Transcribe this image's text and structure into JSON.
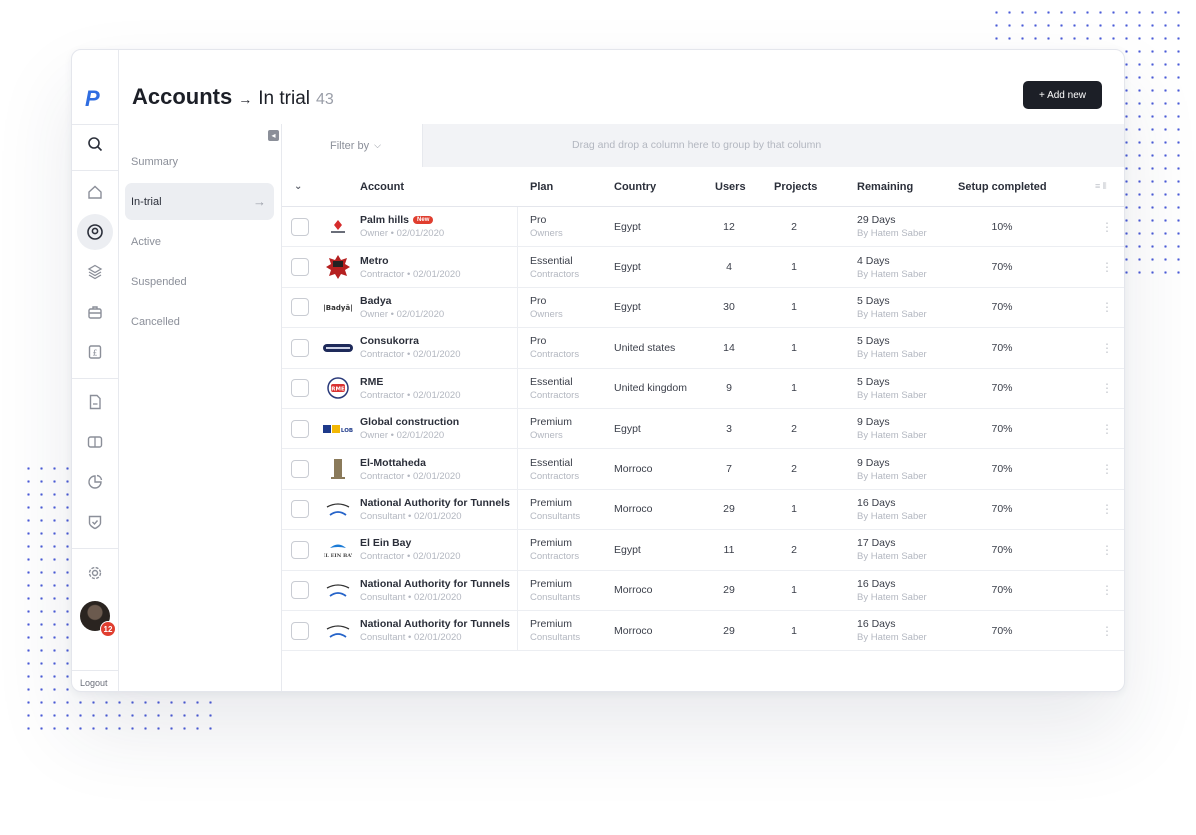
{
  "brand": {
    "logo": "P",
    "accent": "#2f6de1"
  },
  "header": {
    "title": "Accounts",
    "arrow": "→",
    "subtitle": "In trial",
    "count": "43",
    "add_button": "+ Add new"
  },
  "rail": {
    "icons": [
      "search-icon",
      "home-icon",
      "accounts-icon",
      "modules-icon",
      "briefcase-icon",
      "pound-icon",
      "document-icon",
      "card-icon",
      "pie-chart-icon",
      "shield-check-icon",
      "settings-icon"
    ],
    "badge": "12",
    "logout": "Logout"
  },
  "sidebar": {
    "items": [
      {
        "label": "Summary"
      },
      {
        "label": "In-trial",
        "arrow": "→"
      },
      {
        "label": "Active"
      },
      {
        "label": "Suspended"
      },
      {
        "label": "Cancelled"
      }
    ]
  },
  "toolbar": {
    "filter": "Filter by",
    "drag_hint": "Drag and drop a column here to group by that column"
  },
  "table": {
    "columns": [
      "Account",
      "Plan",
      "Country",
      "Users",
      "Projects",
      "Remaining",
      "Setup completed"
    ],
    "rows": [
      {
        "name": "Palm hills",
        "badge": "New",
        "role": "Owner • 02/01/2020",
        "plan": "Pro",
        "plan_group": "Owners",
        "country": "Egypt",
        "users": "12",
        "projects": "2",
        "remaining": "29 Days",
        "by": "By Hatem Saber",
        "setup": "10%",
        "logo": "palm"
      },
      {
        "name": "Metro",
        "badge": "",
        "role": "Contractor • 02/01/2020",
        "plan": "Essential",
        "plan_group": "Contractors",
        "country": "Egypt",
        "users": "4",
        "projects": "1",
        "remaining": "4 Days",
        "by": "By Hatem Saber",
        "setup": "70%",
        "logo": "metro"
      },
      {
        "name": "Badya",
        "badge": "",
        "role": "Owner • 02/01/2020",
        "plan": "Pro",
        "plan_group": "Owners",
        "country": "Egypt",
        "users": "30",
        "projects": "1",
        "remaining": "5 Days",
        "by": "By Hatem Saber",
        "setup": "70%",
        "logo": "badya"
      },
      {
        "name": "Consukorra",
        "badge": "",
        "role": "Contractor • 02/01/2020",
        "plan": "Pro",
        "plan_group": "Contractors",
        "country": "United states",
        "users": "14",
        "projects": "1",
        "remaining": "5 Days",
        "by": "By Hatem Saber",
        "setup": "70%",
        "logo": "consu"
      },
      {
        "name": "RME",
        "badge": "",
        "role": "Contractor • 02/01/2020",
        "plan": "Essential",
        "plan_group": "Contractors",
        "country": "United kingdom",
        "users": "9",
        "projects": "1",
        "remaining": "5 Days",
        "by": "By Hatem Saber",
        "setup": "70%",
        "logo": "rme"
      },
      {
        "name": "Global construction",
        "badge": "",
        "role": "Owner • 02/01/2020",
        "plan": "Premium",
        "plan_group": "Owners",
        "country": "Egypt",
        "users": "3",
        "projects": "2",
        "remaining": "9 Days",
        "by": "By Hatem Saber",
        "setup": "70%",
        "logo": "global"
      },
      {
        "name": "El-Mottaheda",
        "badge": "",
        "role": "Contractor • 02/01/2020",
        "plan": "Essential",
        "plan_group": "Contractors",
        "country": "Morroco",
        "users": "7",
        "projects": "2",
        "remaining": "9 Days",
        "by": "By Hatem Saber",
        "setup": "70%",
        "logo": "mott"
      },
      {
        "name": "National Authority for Tunnels",
        "badge": "",
        "role": "Consultant • 02/01/2020",
        "plan": "Premium",
        "plan_group": "Consultants",
        "country": "Morroco",
        "users": "29",
        "projects": "1",
        "remaining": "16 Days",
        "by": "By Hatem Saber",
        "setup": "70%",
        "logo": "nat"
      },
      {
        "name": "El Ein Bay",
        "badge": "",
        "role": "Contractor • 02/01/2020",
        "plan": "Premium",
        "plan_group": "Contractors",
        "country": "Egypt",
        "users": "11",
        "projects": "2",
        "remaining": "17 Days",
        "by": "By Hatem Saber",
        "setup": "70%",
        "logo": "ein"
      },
      {
        "name": "National Authority for Tunnels",
        "badge": "",
        "role": "Consultant • 02/01/2020",
        "plan": "Premium",
        "plan_group": "Consultants",
        "country": "Morroco",
        "users": "29",
        "projects": "1",
        "remaining": "16 Days",
        "by": "By Hatem Saber",
        "setup": "70%",
        "logo": "nat"
      },
      {
        "name": "National Authority for Tunnels",
        "badge": "",
        "role": "Consultant • 02/01/2020",
        "plan": "Premium",
        "plan_group": "Consultants",
        "country": "Morroco",
        "users": "29",
        "projects": "1",
        "remaining": "16 Days",
        "by": "By Hatem Saber",
        "setup": "70%",
        "logo": "nat"
      }
    ]
  },
  "colors": {
    "text": "#2b2f3a",
    "muted": "#b3b7c0",
    "button_bg": "#1c1f27",
    "badge_red": "#e03e2f",
    "dots": "#4a5bd8"
  }
}
